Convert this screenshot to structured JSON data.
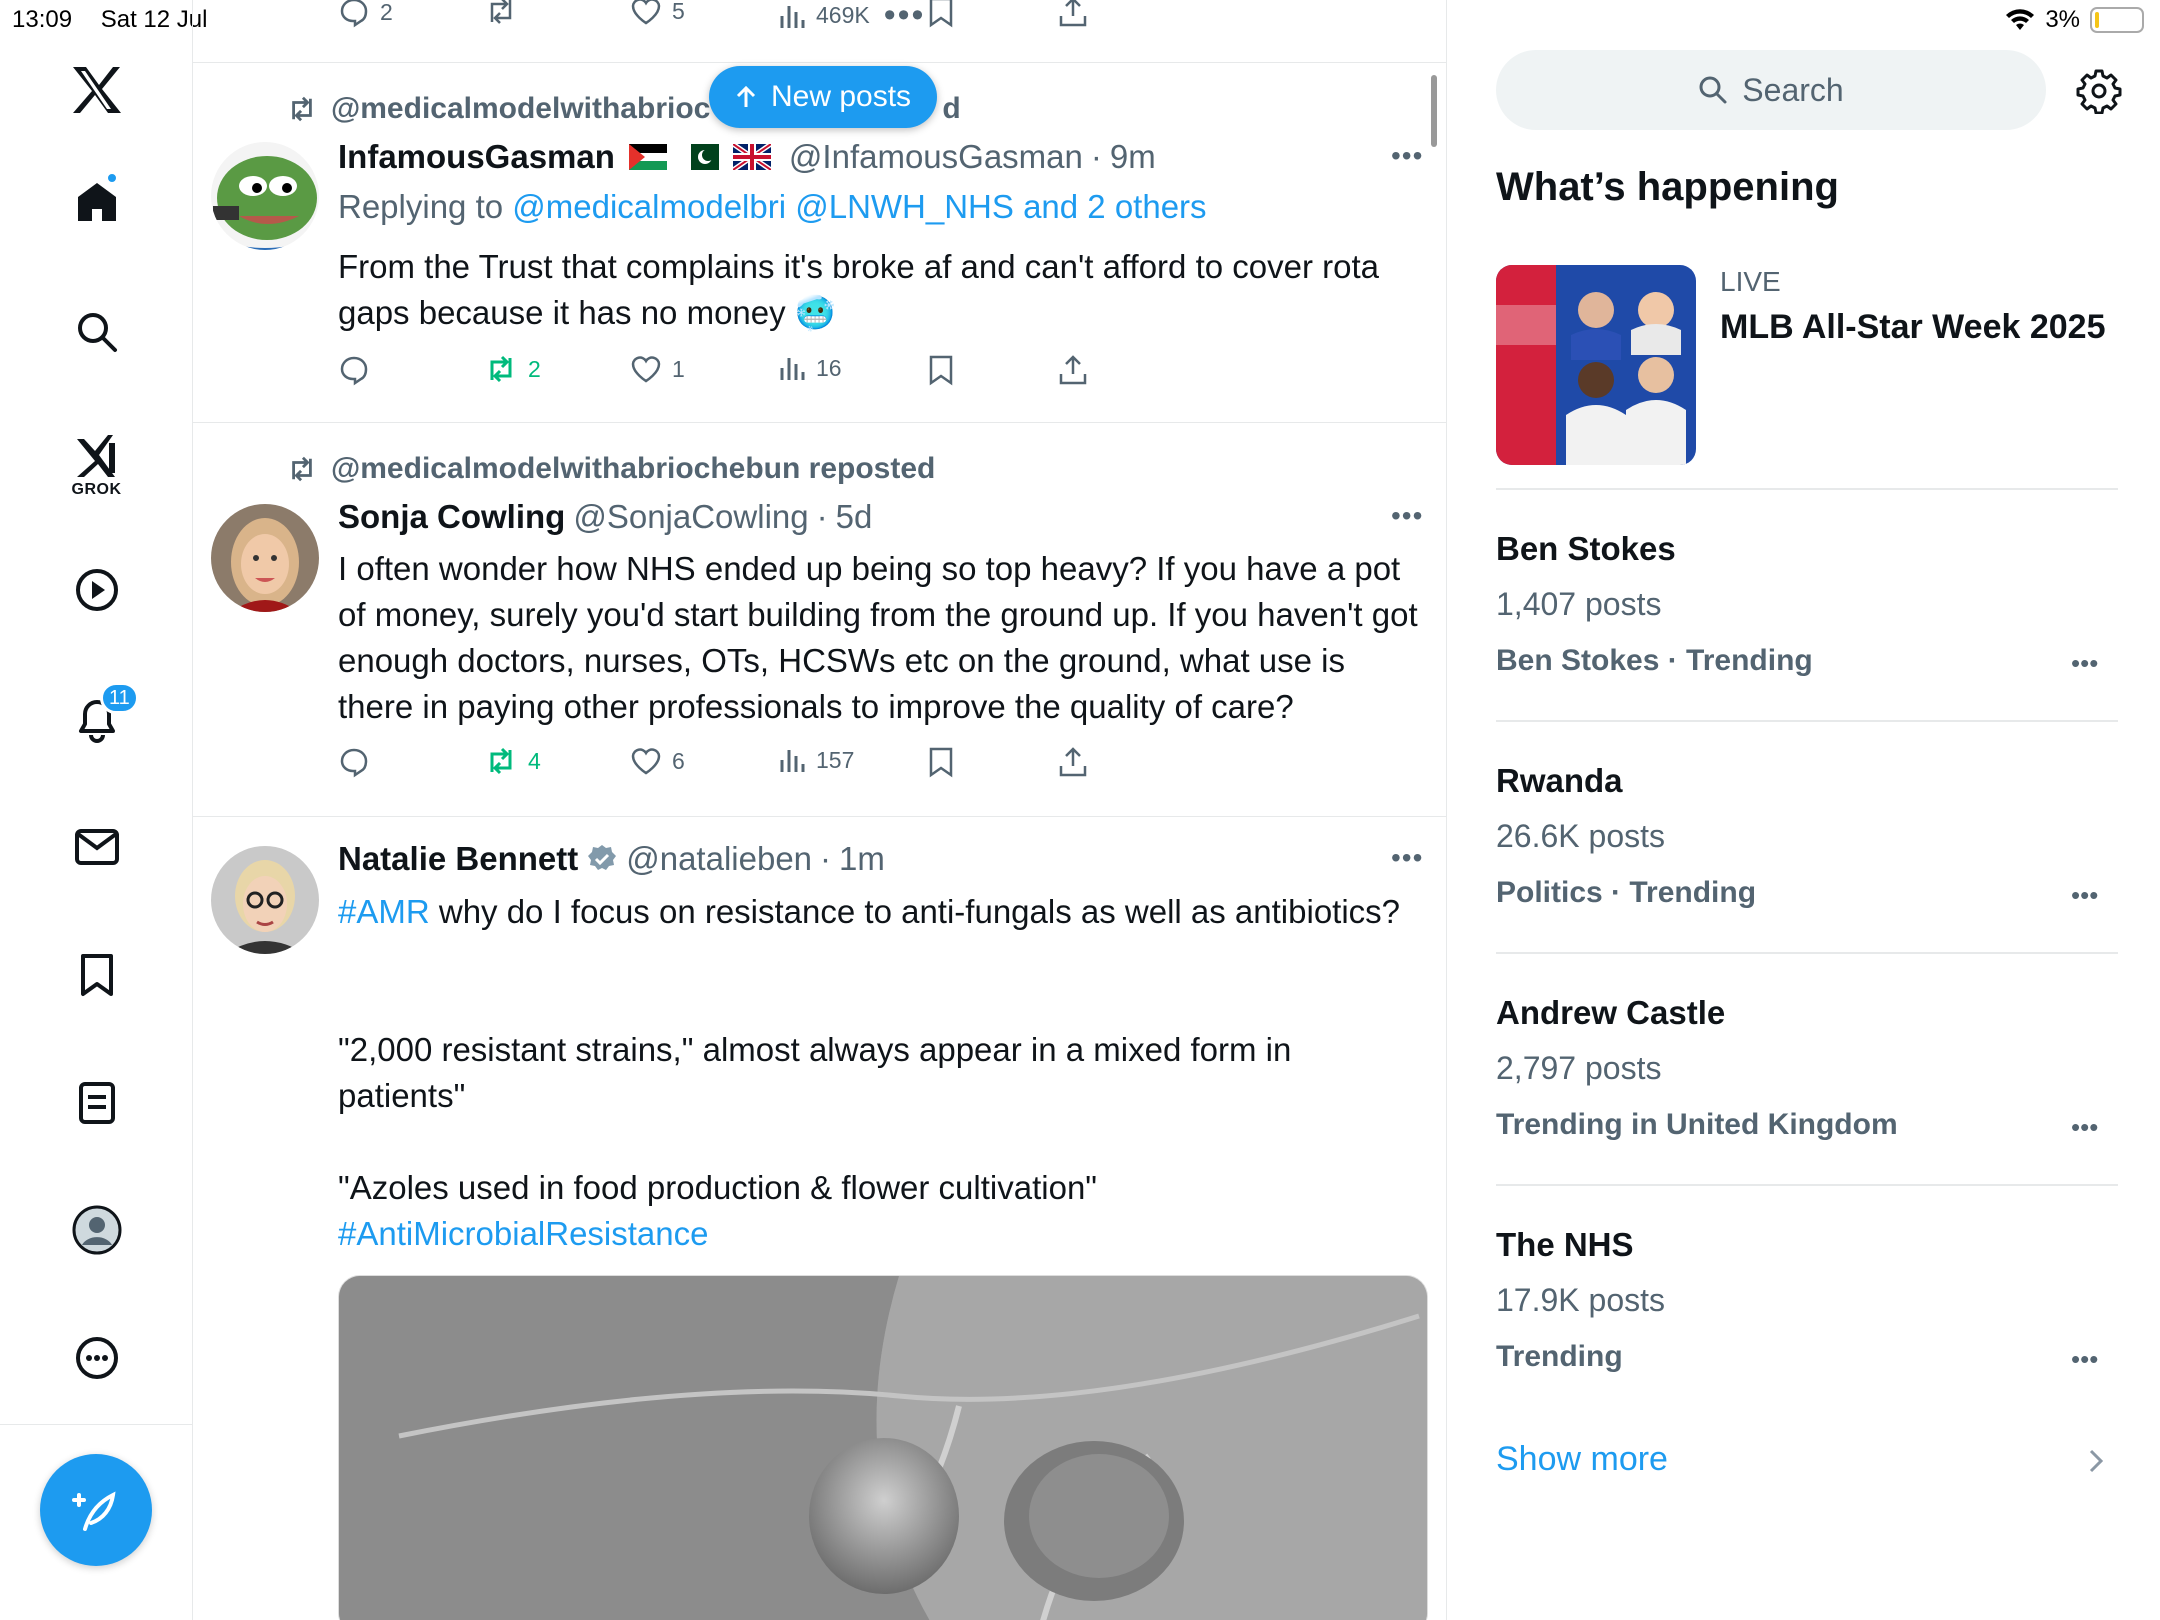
{
  "status_bar": {
    "time": "13:09",
    "date": "Sat 12 Jul",
    "battery": "3%"
  },
  "nav": {
    "grok_label": "GROK",
    "notifications_badge": "11"
  },
  "feed": {
    "prev_tweet_actions": {
      "replies": "2",
      "likes": "5",
      "views": "469K"
    },
    "new_posts_label": "New posts",
    "tweets": [
      {
        "repost_by": "@medicalmodelwithabrioc",
        "repost_suffix": "d",
        "name": "InfamousGasman",
        "handle": "@InfamousGasman",
        "time": "9m",
        "reply_prefix": "Replying to",
        "reply_targets": "@medicalmodelbri @LNWH_NHS and 2 others",
        "text": "From the Trust that complains it's broke af and can't afford to cover rota gaps because it has no money 🥶",
        "retweets": "2",
        "likes": "1",
        "views": "16"
      },
      {
        "repost_by": "@medicalmodelwithabriochebun reposted",
        "name": "Sonja Cowling",
        "handle": "@SonjaCowling",
        "time": "5d",
        "text": "I often wonder how NHS ended up being so top heavy? If you have a pot of money, surely you'd start building from the ground up. If you haven't got enough doctors, nurses, OTs, HCSWs etc on the ground, what use is there in paying other professionals to improve the quality of care?",
        "retweets": "4",
        "likes": "6",
        "views": "157"
      },
      {
        "name": "Natalie Bennett",
        "handle": "@natalieben",
        "time": "1m",
        "hashtag1": "#AMR",
        "line1": " why do I focus on resistance to anti-fungals as well as antibiotics?",
        "quote1": "\"2,000 resistant strains,\" almost always appear in a mixed form in patients\"",
        "quote2": "\"Azoles used in food production & flower cultivation\"",
        "hashtag2": "#AntiMicrobialResistance"
      }
    ]
  },
  "sidebar": {
    "search_placeholder": "Search",
    "section_title": "What’s happening",
    "live": {
      "label": "LIVE",
      "title": "MLB All-Star Week 2025"
    },
    "trends": [
      {
        "name": "Ben Stokes",
        "count": "1,407 posts",
        "meta": "Ben Stokes · Trending"
      },
      {
        "name": "Rwanda",
        "count": "26.6K posts",
        "meta": "Politics · Trending"
      },
      {
        "name": "Andrew Castle",
        "count": "2,797 posts",
        "meta": "Trending in United Kingdom"
      },
      {
        "name": "The NHS",
        "count": "17.9K posts",
        "meta": "Trending"
      }
    ],
    "show_more": "Show more"
  },
  "colors": {
    "accent": "#1d9bf0",
    "retweet_green": "#00ba7c",
    "muted": "#536471"
  }
}
